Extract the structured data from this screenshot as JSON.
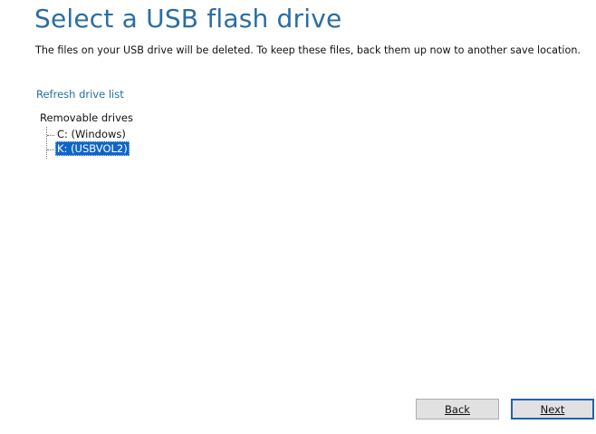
{
  "header": {
    "title": "Select a USB flash drive",
    "description": "The files on your USB drive will be deleted. To keep these files, back them up now to another save location."
  },
  "refresh_link": "Refresh drive list",
  "drive_tree": {
    "root_label": "Removable drives",
    "items": [
      {
        "label": "C: (Windows)",
        "selected": false
      },
      {
        "label": "K: (USBVOL2)",
        "selected": true
      }
    ]
  },
  "buttons": {
    "back_label": "Back",
    "next_label": "Next"
  },
  "colors": {
    "title": "#2b6ea3",
    "link": "#1f6fa8",
    "selection": "#1065c7",
    "default_button_border": "#1f62b5"
  }
}
